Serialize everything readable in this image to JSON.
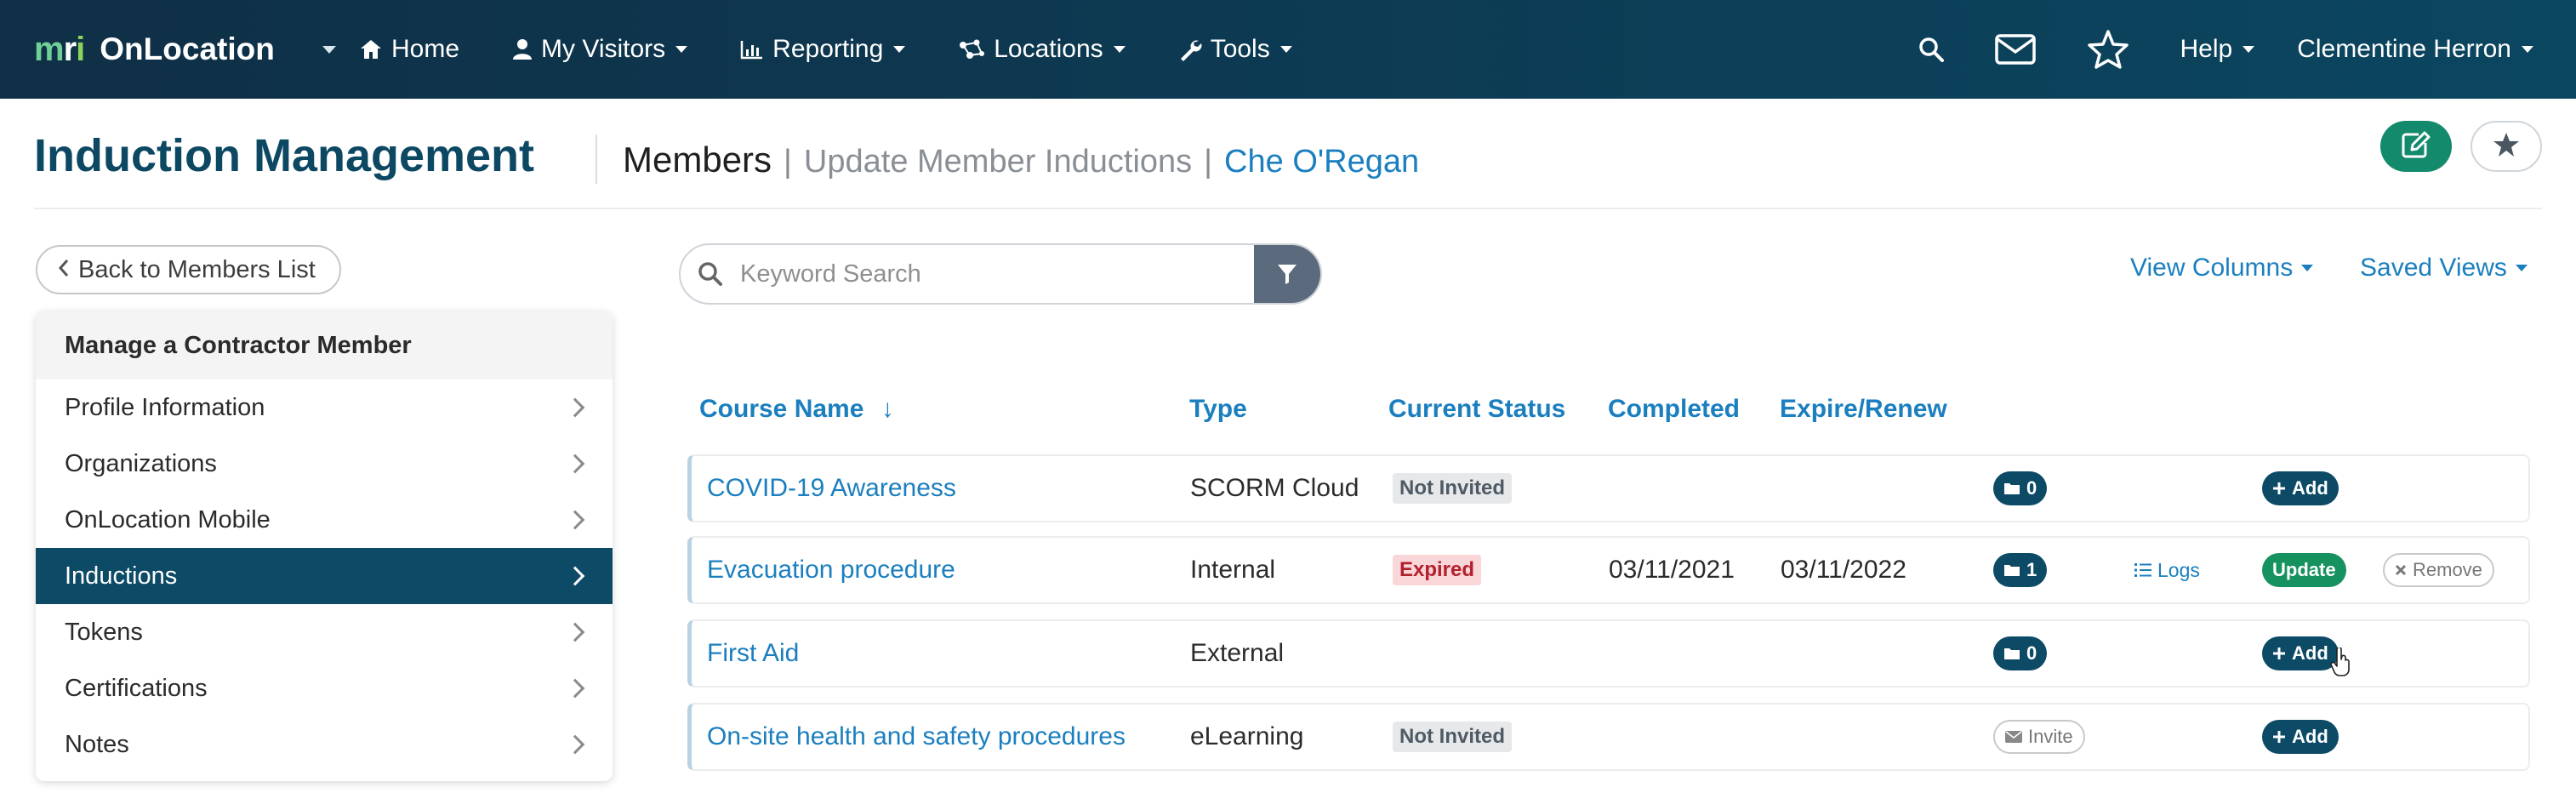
{
  "app": {
    "logo_text": "mri",
    "name": "OnLocation"
  },
  "nav": {
    "items": [
      {
        "label": "Home",
        "icon": "home-icon"
      },
      {
        "label": "My Visitors",
        "icon": "user-icon"
      },
      {
        "label": "Reporting",
        "icon": "chart-icon"
      },
      {
        "label": "Locations",
        "icon": "network-icon"
      },
      {
        "label": "Tools",
        "icon": "wrench-icon"
      }
    ],
    "help_label": "Help",
    "user_name": "Clementine Herron"
  },
  "header": {
    "title": "Induction Management",
    "crumb_current": "Members",
    "crumb_separator": "|",
    "crumb_page": "Update Member Inductions",
    "crumb_member": "Che O'Regan"
  },
  "sidebar": {
    "back_label": "Back to Members List",
    "heading": "Manage a Contractor Member",
    "items": [
      {
        "label": "Profile Information",
        "active": false
      },
      {
        "label": "Organizations",
        "active": false
      },
      {
        "label": "OnLocation Mobile",
        "active": false
      },
      {
        "label": "Inductions",
        "active": true
      },
      {
        "label": "Tokens",
        "active": false
      },
      {
        "label": "Certifications",
        "active": false
      },
      {
        "label": "Notes",
        "active": false
      }
    ]
  },
  "toolbar": {
    "search_placeholder": "Keyword Search",
    "view_columns_label": "View Columns",
    "saved_views_label": "Saved Views"
  },
  "table": {
    "columns": {
      "course": "Course Name",
      "sort_indicator": "↓",
      "type": "Type",
      "status": "Current Status",
      "completed": "Completed",
      "expire": "Expire/Renew"
    },
    "rows": [
      {
        "course": "COVID-19 Awareness",
        "type": "SCORM Cloud",
        "status": "Not Invited",
        "completed": "",
        "expire": "",
        "docs": "0",
        "add": "Add"
      },
      {
        "course": "Evacuation procedure",
        "type": "Internal",
        "status": "Expired",
        "completed": "03/11/2021",
        "expire": "03/11/2022",
        "docs": "1",
        "logs": "Logs",
        "update": "Update",
        "remove": "Remove"
      },
      {
        "course": "First Aid",
        "type": "External",
        "status": "",
        "completed": "",
        "expire": "",
        "docs": "0",
        "add": "Add"
      },
      {
        "course": "On-site health and safety procedures",
        "type": "eLearning",
        "status": "Not Invited",
        "completed": "",
        "expire": "",
        "invite": "Invite",
        "add": "Add"
      }
    ]
  },
  "colors": {
    "nav_bg": "#0f2f46",
    "accent_blue": "#1b7fbf",
    "title_teal": "#0d4863",
    "active_item": "#0c4a66",
    "success_green": "#15925f",
    "danger_red": "#b3202d"
  }
}
